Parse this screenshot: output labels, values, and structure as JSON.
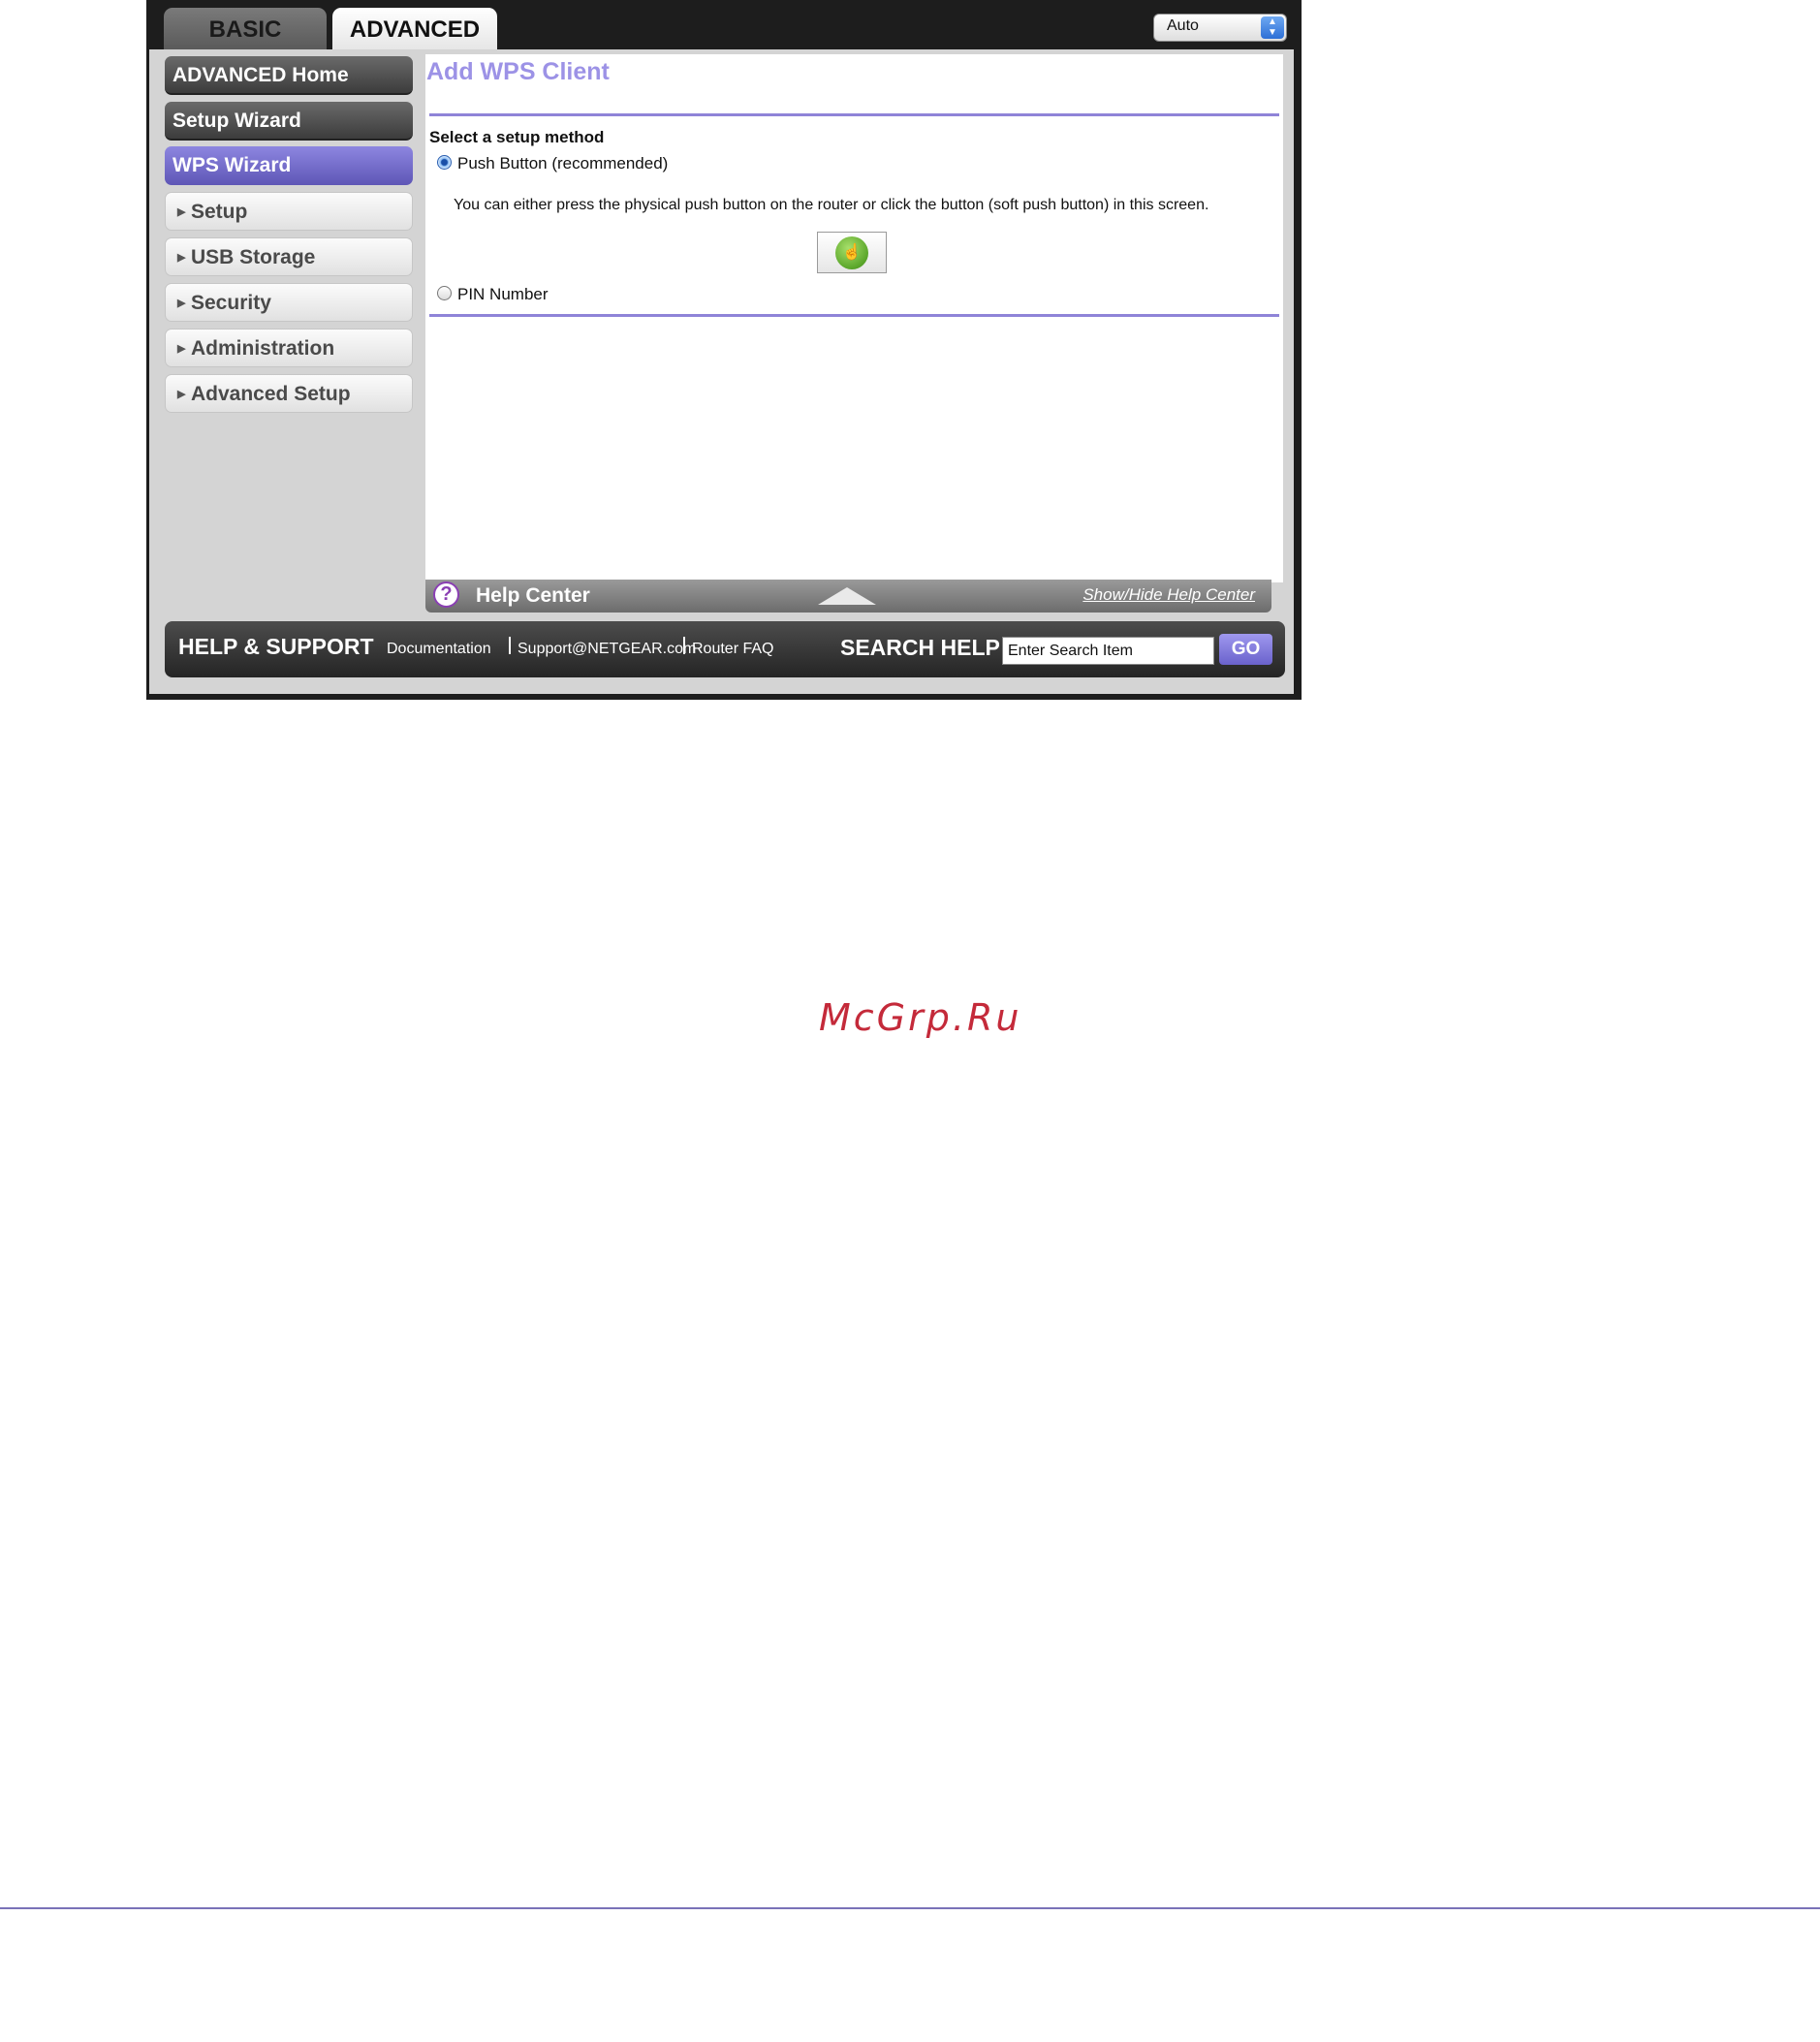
{
  "tabs": [
    {
      "label": "BASIC",
      "active": false
    },
    {
      "label": "ADVANCED",
      "active": true
    }
  ],
  "language_select": {
    "value": "Auto"
  },
  "sidebar": {
    "items": [
      {
        "label": "ADVANCED Home"
      },
      {
        "label": "Setup Wizard"
      },
      {
        "label": "WPS Wizard",
        "active": true
      },
      {
        "label": "Setup"
      },
      {
        "label": "USB Storage"
      },
      {
        "label": "Security"
      },
      {
        "label": "Administration"
      },
      {
        "label": "Advanced Setup"
      }
    ]
  },
  "main": {
    "title": "Add WPS Client",
    "method_label": "Select a setup method",
    "option_push": "Push Button (recommended)",
    "push_description": "You can either press the physical push button on the router or click the button (soft push button) in this screen.",
    "option_pin": "PIN Number",
    "selected_option": "push"
  },
  "help_center": {
    "label": "Help Center",
    "toggle": "Show/Hide Help Center"
  },
  "footer": {
    "title": "HELP & SUPPORT",
    "links": [
      "Documentation",
      "Support@NETGEAR.com",
      "Router FAQ"
    ],
    "search_title": "SEARCH HELP",
    "search_value": "Enter Search Item",
    "go_label": "GO"
  },
  "watermark": "McGrp.Ru",
  "colors": {
    "accent_purple": "#8f84d8",
    "title_purple": "#9c92e6",
    "watermark_red": "#c42a3a"
  }
}
